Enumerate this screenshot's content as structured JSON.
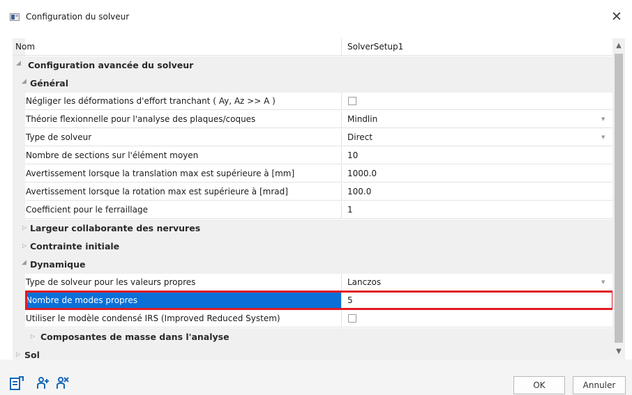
{
  "window": {
    "title": "Configuration du solveur",
    "close_glyph": "✕"
  },
  "header": {
    "name_label": "Nom",
    "name_value": "SolverSetup1"
  },
  "sections": {
    "advanced": "Configuration avancée du solveur",
    "general": "Général",
    "largeur": "Largeur collaborante des nervures",
    "contrainte": "Contrainte initiale",
    "dynamique": "Dynamique",
    "composantes": "Composantes de masse dans l'analyse",
    "sol": "Sol"
  },
  "general_rows": [
    {
      "label": "Négliger les déformations d'effort tranchant ( Ay, Az >> A )",
      "value": "",
      "kind": "checkbox",
      "checked": false
    },
    {
      "label": "Théorie flexionnelle pour l'analyse des plaques/coques",
      "value": "Mindlin",
      "kind": "dropdown"
    },
    {
      "label": "Type de solveur",
      "value": "Direct",
      "kind": "dropdown"
    },
    {
      "label": "Nombre de sections sur l'élément moyen",
      "value": "10",
      "kind": "text"
    },
    {
      "label": "Avertissement lorsque la translation max est supérieure à [mm]",
      "value": "1000.0",
      "kind": "text"
    },
    {
      "label": "Avertissement lorsque la rotation max est supérieure à [mrad]",
      "value": "100.0",
      "kind": "text"
    },
    {
      "label": "Coefficient pour le ferraillage",
      "value": "1",
      "kind": "text"
    }
  ],
  "dynamique_rows": [
    {
      "label": "Type de solveur pour les valeurs propres",
      "value": "Lanczos",
      "kind": "dropdown"
    },
    {
      "label": "Nombre de modes propres",
      "value": "5",
      "kind": "text",
      "selected": true
    },
    {
      "label": "Utiliser le modèle condensé IRS (Improved Reduced System)",
      "value": "",
      "kind": "checkbox",
      "checked": false
    }
  ],
  "footer": {
    "ok_label": "OK",
    "cancel_label": "Annuler",
    "tools": [
      "document-export-icon",
      "add-users-icon",
      "user-settings-icon"
    ]
  },
  "colors": {
    "selection": "#0a70d8",
    "highlight": "#e11b25",
    "section_bg": "#f0f0f0",
    "tool_icon": "#1466b8"
  }
}
